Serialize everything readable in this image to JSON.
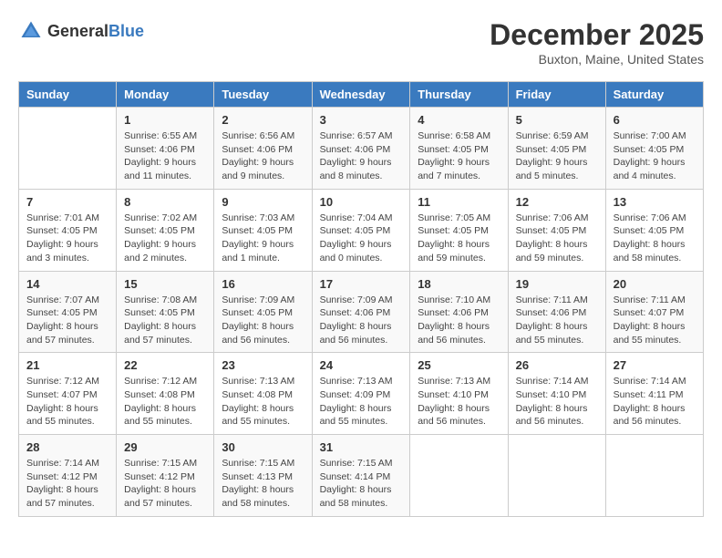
{
  "logo": {
    "general": "General",
    "blue": "Blue"
  },
  "title": "December 2025",
  "location": "Buxton, Maine, United States",
  "days_header": [
    "Sunday",
    "Monday",
    "Tuesday",
    "Wednesday",
    "Thursday",
    "Friday",
    "Saturday"
  ],
  "weeks": [
    [
      {
        "day": "",
        "detail": ""
      },
      {
        "day": "1",
        "detail": "Sunrise: 6:55 AM\nSunset: 4:06 PM\nDaylight: 9 hours\nand 11 minutes."
      },
      {
        "day": "2",
        "detail": "Sunrise: 6:56 AM\nSunset: 4:06 PM\nDaylight: 9 hours\nand 9 minutes."
      },
      {
        "day": "3",
        "detail": "Sunrise: 6:57 AM\nSunset: 4:06 PM\nDaylight: 9 hours\nand 8 minutes."
      },
      {
        "day": "4",
        "detail": "Sunrise: 6:58 AM\nSunset: 4:05 PM\nDaylight: 9 hours\nand 7 minutes."
      },
      {
        "day": "5",
        "detail": "Sunrise: 6:59 AM\nSunset: 4:05 PM\nDaylight: 9 hours\nand 5 minutes."
      },
      {
        "day": "6",
        "detail": "Sunrise: 7:00 AM\nSunset: 4:05 PM\nDaylight: 9 hours\nand 4 minutes."
      }
    ],
    [
      {
        "day": "7",
        "detail": "Sunrise: 7:01 AM\nSunset: 4:05 PM\nDaylight: 9 hours\nand 3 minutes."
      },
      {
        "day": "8",
        "detail": "Sunrise: 7:02 AM\nSunset: 4:05 PM\nDaylight: 9 hours\nand 2 minutes."
      },
      {
        "day": "9",
        "detail": "Sunrise: 7:03 AM\nSunset: 4:05 PM\nDaylight: 9 hours\nand 1 minute."
      },
      {
        "day": "10",
        "detail": "Sunrise: 7:04 AM\nSunset: 4:05 PM\nDaylight: 9 hours\nand 0 minutes."
      },
      {
        "day": "11",
        "detail": "Sunrise: 7:05 AM\nSunset: 4:05 PM\nDaylight: 8 hours\nand 59 minutes."
      },
      {
        "day": "12",
        "detail": "Sunrise: 7:06 AM\nSunset: 4:05 PM\nDaylight: 8 hours\nand 59 minutes."
      },
      {
        "day": "13",
        "detail": "Sunrise: 7:06 AM\nSunset: 4:05 PM\nDaylight: 8 hours\nand 58 minutes."
      }
    ],
    [
      {
        "day": "14",
        "detail": "Sunrise: 7:07 AM\nSunset: 4:05 PM\nDaylight: 8 hours\nand 57 minutes."
      },
      {
        "day": "15",
        "detail": "Sunrise: 7:08 AM\nSunset: 4:05 PM\nDaylight: 8 hours\nand 57 minutes."
      },
      {
        "day": "16",
        "detail": "Sunrise: 7:09 AM\nSunset: 4:05 PM\nDaylight: 8 hours\nand 56 minutes."
      },
      {
        "day": "17",
        "detail": "Sunrise: 7:09 AM\nSunset: 4:06 PM\nDaylight: 8 hours\nand 56 minutes."
      },
      {
        "day": "18",
        "detail": "Sunrise: 7:10 AM\nSunset: 4:06 PM\nDaylight: 8 hours\nand 56 minutes."
      },
      {
        "day": "19",
        "detail": "Sunrise: 7:11 AM\nSunset: 4:06 PM\nDaylight: 8 hours\nand 55 minutes."
      },
      {
        "day": "20",
        "detail": "Sunrise: 7:11 AM\nSunset: 4:07 PM\nDaylight: 8 hours\nand 55 minutes."
      }
    ],
    [
      {
        "day": "21",
        "detail": "Sunrise: 7:12 AM\nSunset: 4:07 PM\nDaylight: 8 hours\nand 55 minutes."
      },
      {
        "day": "22",
        "detail": "Sunrise: 7:12 AM\nSunset: 4:08 PM\nDaylight: 8 hours\nand 55 minutes."
      },
      {
        "day": "23",
        "detail": "Sunrise: 7:13 AM\nSunset: 4:08 PM\nDaylight: 8 hours\nand 55 minutes."
      },
      {
        "day": "24",
        "detail": "Sunrise: 7:13 AM\nSunset: 4:09 PM\nDaylight: 8 hours\nand 55 minutes."
      },
      {
        "day": "25",
        "detail": "Sunrise: 7:13 AM\nSunset: 4:10 PM\nDaylight: 8 hours\nand 56 minutes."
      },
      {
        "day": "26",
        "detail": "Sunrise: 7:14 AM\nSunset: 4:10 PM\nDaylight: 8 hours\nand 56 minutes."
      },
      {
        "day": "27",
        "detail": "Sunrise: 7:14 AM\nSunset: 4:11 PM\nDaylight: 8 hours\nand 56 minutes."
      }
    ],
    [
      {
        "day": "28",
        "detail": "Sunrise: 7:14 AM\nSunset: 4:12 PM\nDaylight: 8 hours\nand 57 minutes."
      },
      {
        "day": "29",
        "detail": "Sunrise: 7:15 AM\nSunset: 4:12 PM\nDaylight: 8 hours\nand 57 minutes."
      },
      {
        "day": "30",
        "detail": "Sunrise: 7:15 AM\nSunset: 4:13 PM\nDaylight: 8 hours\nand 58 minutes."
      },
      {
        "day": "31",
        "detail": "Sunrise: 7:15 AM\nSunset: 4:14 PM\nDaylight: 8 hours\nand 58 minutes."
      },
      {
        "day": "",
        "detail": ""
      },
      {
        "day": "",
        "detail": ""
      },
      {
        "day": "",
        "detail": ""
      }
    ]
  ]
}
